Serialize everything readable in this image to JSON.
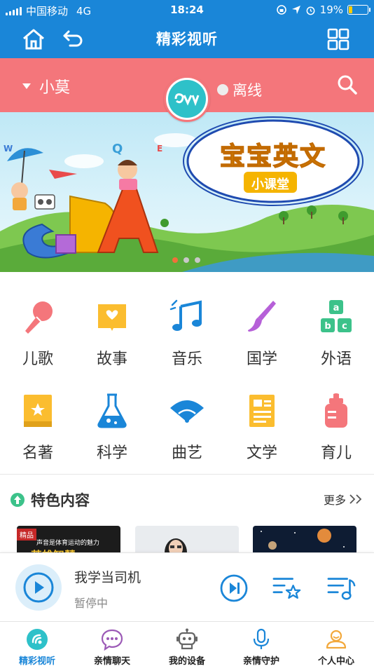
{
  "status_bar": {
    "carrier": "中国移动",
    "network": "4G",
    "time": "18:24",
    "battery_text": "19%",
    "battery_level": 0.19
  },
  "nav": {
    "title": "精彩视听",
    "icons": [
      "home-icon",
      "back-icon",
      "grid-icon"
    ]
  },
  "user_bar": {
    "name": "小莫",
    "status": "离线",
    "colors": {
      "background": "#f4767b",
      "logo": "#2ec1c9"
    }
  },
  "banner": {
    "title": "宝宝英文",
    "subtitle": "小课堂",
    "letters": "CBA",
    "pages": 3,
    "active_page": 1
  },
  "categories": [
    {
      "label": "儿歌",
      "icon": "microphone-icon",
      "color": "#f4767b"
    },
    {
      "label": "故事",
      "icon": "storybook-icon",
      "color": "#fbbd2f"
    },
    {
      "label": "音乐",
      "icon": "music-note-icon",
      "color": "#1a86d8"
    },
    {
      "label": "国学",
      "icon": "brush-icon",
      "color": "#b660d8"
    },
    {
      "label": "外语",
      "icon": "abc-blocks-icon",
      "color": "#3cc28a"
    },
    {
      "label": "名著",
      "icon": "book-star-icon",
      "color": "#fbbd2f"
    },
    {
      "label": "科学",
      "icon": "flask-icon",
      "color": "#1a86d8"
    },
    {
      "label": "曲艺",
      "icon": "fan-icon",
      "color": "#1a86d8"
    },
    {
      "label": "文学",
      "icon": "document-icon",
      "color": "#fbbd2f"
    },
    {
      "label": "育儿",
      "icon": "baby-bottle-icon",
      "color": "#f4767b"
    }
  ],
  "featured": {
    "title": "特色内容",
    "more": "更多",
    "thumb1_badge": "精品",
    "thumb1_caption": "声音是体育运动的魅力",
    "thumb1_title": "英雄智慧"
  },
  "player": {
    "track": "我学当司机",
    "state": "暂停中"
  },
  "tabs": [
    {
      "label": "精彩视听",
      "icon": "radio-wave-icon",
      "active": true
    },
    {
      "label": "亲情聊天",
      "icon": "chat-bubble-icon",
      "active": false
    },
    {
      "label": "我的设备",
      "icon": "robot-icon",
      "active": false
    },
    {
      "label": "亲情守护",
      "icon": "microphone-icon",
      "active": false
    },
    {
      "label": "个人中心",
      "icon": "person-icon",
      "active": false
    }
  ]
}
